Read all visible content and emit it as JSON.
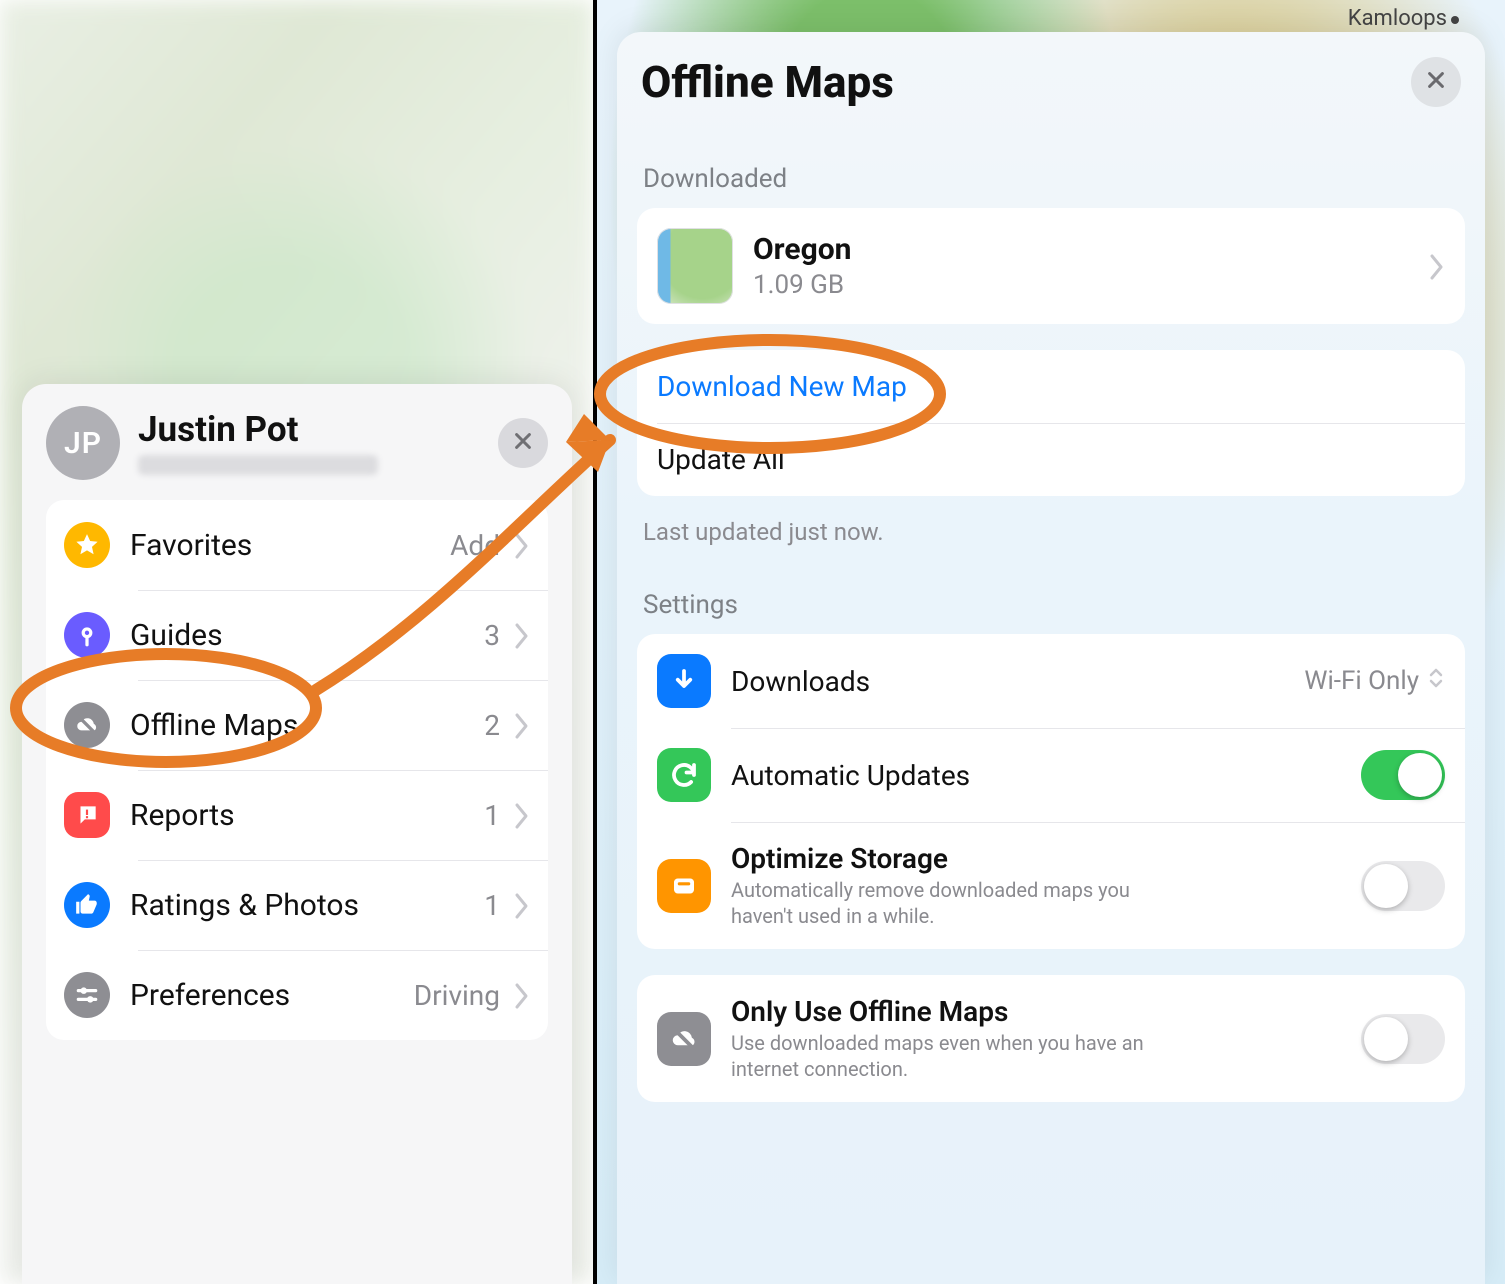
{
  "left": {
    "profile": {
      "initials": "JP",
      "name": "Justin Pot"
    },
    "menu": {
      "favorites": {
        "label": "Favorites",
        "tail": "Add"
      },
      "guides": {
        "label": "Guides",
        "count": "3"
      },
      "offline": {
        "label": "Offline Maps",
        "count": "2"
      },
      "reports": {
        "label": "Reports",
        "count": "1"
      },
      "ratings": {
        "label": "Ratings & Photos",
        "count": "1"
      },
      "prefs": {
        "label": "Preferences",
        "tail": "Driving"
      }
    }
  },
  "right": {
    "title": "Offline Maps",
    "mapLabel": "Kamloops",
    "sections": {
      "downloaded": "Downloaded",
      "settings": "Settings"
    },
    "map_item": {
      "name": "Oregon",
      "size": "1.09 GB"
    },
    "actions": {
      "download_new": "Download New Map",
      "update_all": "Update All"
    },
    "last_updated": "Last updated just now.",
    "settings": {
      "downloads": {
        "label": "Downloads",
        "value": "Wi-Fi Only"
      },
      "auto": {
        "label": "Automatic Updates",
        "on": true
      },
      "optimize": {
        "label": "Optimize Storage",
        "sub": "Automatically remove downloaded maps you haven't used in a while.",
        "on": false
      },
      "only_offline": {
        "label": "Only Use Offline Maps",
        "sub": "Use downloaded maps even when you have an internet connection.",
        "on": false
      }
    }
  }
}
